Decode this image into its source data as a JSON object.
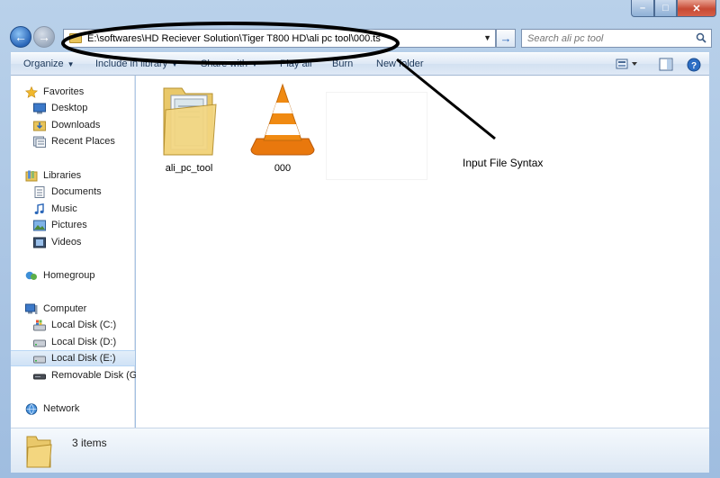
{
  "window": {
    "controls": {
      "minimize": "–",
      "maximize": "□",
      "close": "✕"
    }
  },
  "nav": {
    "back_icon": "back-arrow-icon",
    "forward_icon": "forward-arrow-icon",
    "address": "E:\\softwares\\HD Reciever Solution\\Tiger T800 HD\\ali pc tool\\000.ts",
    "search_placeholder": "Search ali pc tool"
  },
  "toolbar": {
    "organize": "Organize",
    "include_in_library": "Include in library",
    "share_with": "Share with",
    "play_all": "Play all",
    "burn": "Burn",
    "new_folder": "New folder"
  },
  "sidebar": {
    "favorites": {
      "label": "Favorites",
      "items": [
        {
          "label": "Desktop",
          "icon": "desktop-icon"
        },
        {
          "label": "Downloads",
          "icon": "downloads-icon"
        },
        {
          "label": "Recent Places",
          "icon": "recent-places-icon"
        }
      ]
    },
    "libraries": {
      "label": "Libraries",
      "items": [
        {
          "label": "Documents",
          "icon": "documents-icon"
        },
        {
          "label": "Music",
          "icon": "music-icon"
        },
        {
          "label": "Pictures",
          "icon": "pictures-icon"
        },
        {
          "label": "Videos",
          "icon": "videos-icon"
        }
      ]
    },
    "homegroup": {
      "label": "Homegroup"
    },
    "computer": {
      "label": "Computer",
      "items": [
        {
          "label": "Local Disk (C:)",
          "icon": "windows-drive-icon"
        },
        {
          "label": "Local Disk (D:)",
          "icon": "drive-icon"
        },
        {
          "label": "Local Disk (E:)",
          "icon": "drive-icon",
          "selected": true
        },
        {
          "label": "Removable Disk (G:)",
          "icon": "removable-drive-icon"
        }
      ]
    },
    "network": {
      "label": "Network"
    }
  },
  "files": [
    {
      "name": "ali_pc_tool",
      "icon": "folder-icon"
    },
    {
      "name": "000",
      "icon": "vlc-icon"
    }
  ],
  "annotation": {
    "text": "Input File Syntax"
  },
  "status": {
    "item_count": "3 items"
  },
  "colors": {
    "accent": "#1f5fb6",
    "selection": "#cfe2f6",
    "vlc_orange": "#f08a12"
  }
}
